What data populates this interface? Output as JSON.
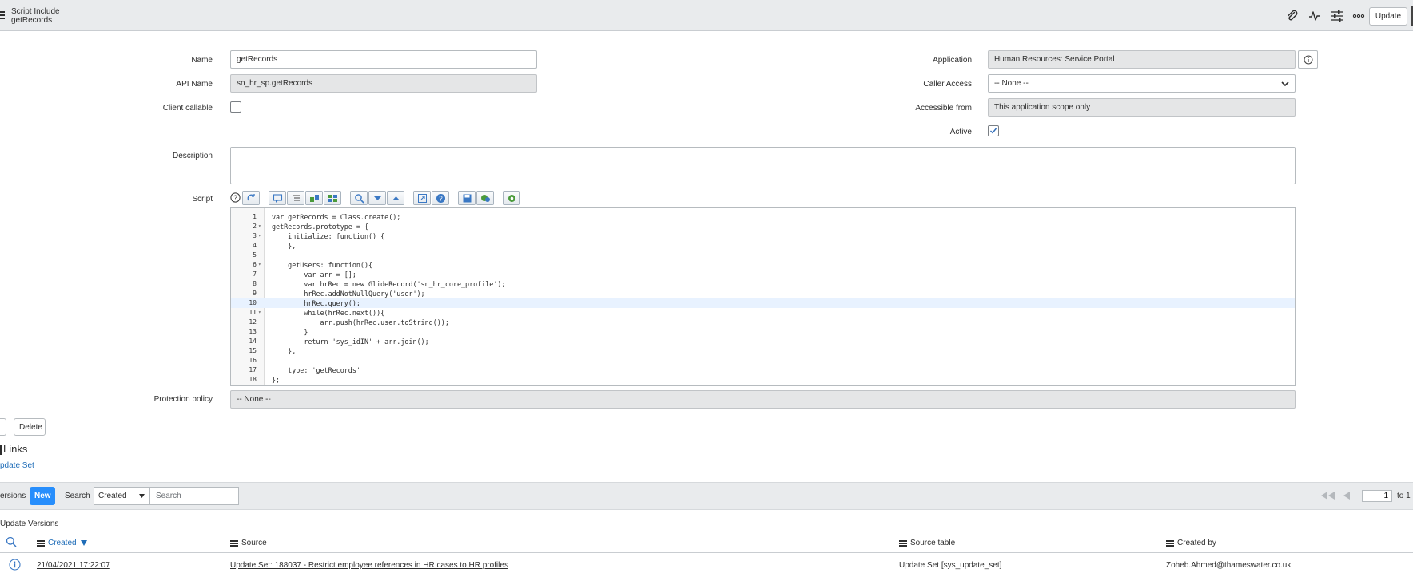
{
  "header": {
    "record_type": "Script Include",
    "record_name": "getRecords",
    "update_label": "Update",
    "icons": [
      "paperclip-icon",
      "activity-icon",
      "settings-sliders-icon",
      "more-icon"
    ]
  },
  "form": {
    "name_label": "Name",
    "name_value": "getRecords",
    "api_name_label": "API Name",
    "api_name_value": "sn_hr_sp.getRecords",
    "client_callable_label": "Client callable",
    "client_callable_checked": false,
    "application_label": "Application",
    "application_value": "Human Resources: Service Portal",
    "caller_access_label": "Caller Access",
    "caller_access_value": "-- None --",
    "accessible_from_label": "Accessible from",
    "accessible_from_value": "This application scope only",
    "active_label": "Active",
    "active_checked": true,
    "description_label": "Description",
    "description_value": "",
    "script_label": "Script",
    "protection_policy_label": "Protection policy",
    "protection_policy_value": "-- None --",
    "delete_label": "Delete"
  },
  "script": {
    "active_line": 10,
    "lines": [
      {
        "n": "1",
        "fold": "",
        "text": "var getRecords = Class.create();"
      },
      {
        "n": "2",
        "fold": "▾",
        "text": "getRecords.prototype = {"
      },
      {
        "n": "3",
        "fold": "▾",
        "text": "    initialize: function() {"
      },
      {
        "n": "4",
        "fold": "",
        "text": "    },"
      },
      {
        "n": "5",
        "fold": "",
        "text": ""
      },
      {
        "n": "6",
        "fold": "▾",
        "text": "    getUsers: function(){"
      },
      {
        "n": "7",
        "fold": "",
        "text": "        var arr = [];"
      },
      {
        "n": "8",
        "fold": "",
        "text": "        var hrRec = new GlideRecord('sn_hr_core_profile');"
      },
      {
        "n": "9",
        "fold": "",
        "text": "        hrRec.addNotNullQuery('user');"
      },
      {
        "n": "10",
        "fold": "",
        "text": "        hrRec.query();"
      },
      {
        "n": "11",
        "fold": "▾",
        "text": "        while(hrRec.next()){"
      },
      {
        "n": "12",
        "fold": "",
        "text": "            arr.push(hrRec.user.toString());"
      },
      {
        "n": "13",
        "fold": "",
        "text": "        }"
      },
      {
        "n": "14",
        "fold": "",
        "text": "        return 'sys_idIN' + arr.join();"
      },
      {
        "n": "15",
        "fold": "",
        "text": "    },"
      },
      {
        "n": "16",
        "fold": "",
        "text": ""
      },
      {
        "n": "17",
        "fold": "",
        "text": "    type: 'getRecords'"
      },
      {
        "n": "18",
        "fold": "",
        "text": "};"
      }
    ]
  },
  "related": {
    "title": "Links",
    "link": "pdate Set"
  },
  "list": {
    "tab_label": "ersions",
    "new_label": "New",
    "search_label": "Search",
    "search_field": "Created",
    "search_placeholder": "Search",
    "page_value": "1",
    "page_suffix": "to 1",
    "caption": "Update Versions",
    "columns": [
      "Created",
      "Source",
      "Source table",
      "Created by"
    ],
    "rows": [
      {
        "created": "21/04/2021 17:22:07",
        "source": "Update Set: 188037 - Restrict employee references in HR cases to HR profiles",
        "source_table": "Update Set [sys_update_set]",
        "created_by": "Zoheb.Ahmed@thameswater.co.uk"
      }
    ]
  }
}
